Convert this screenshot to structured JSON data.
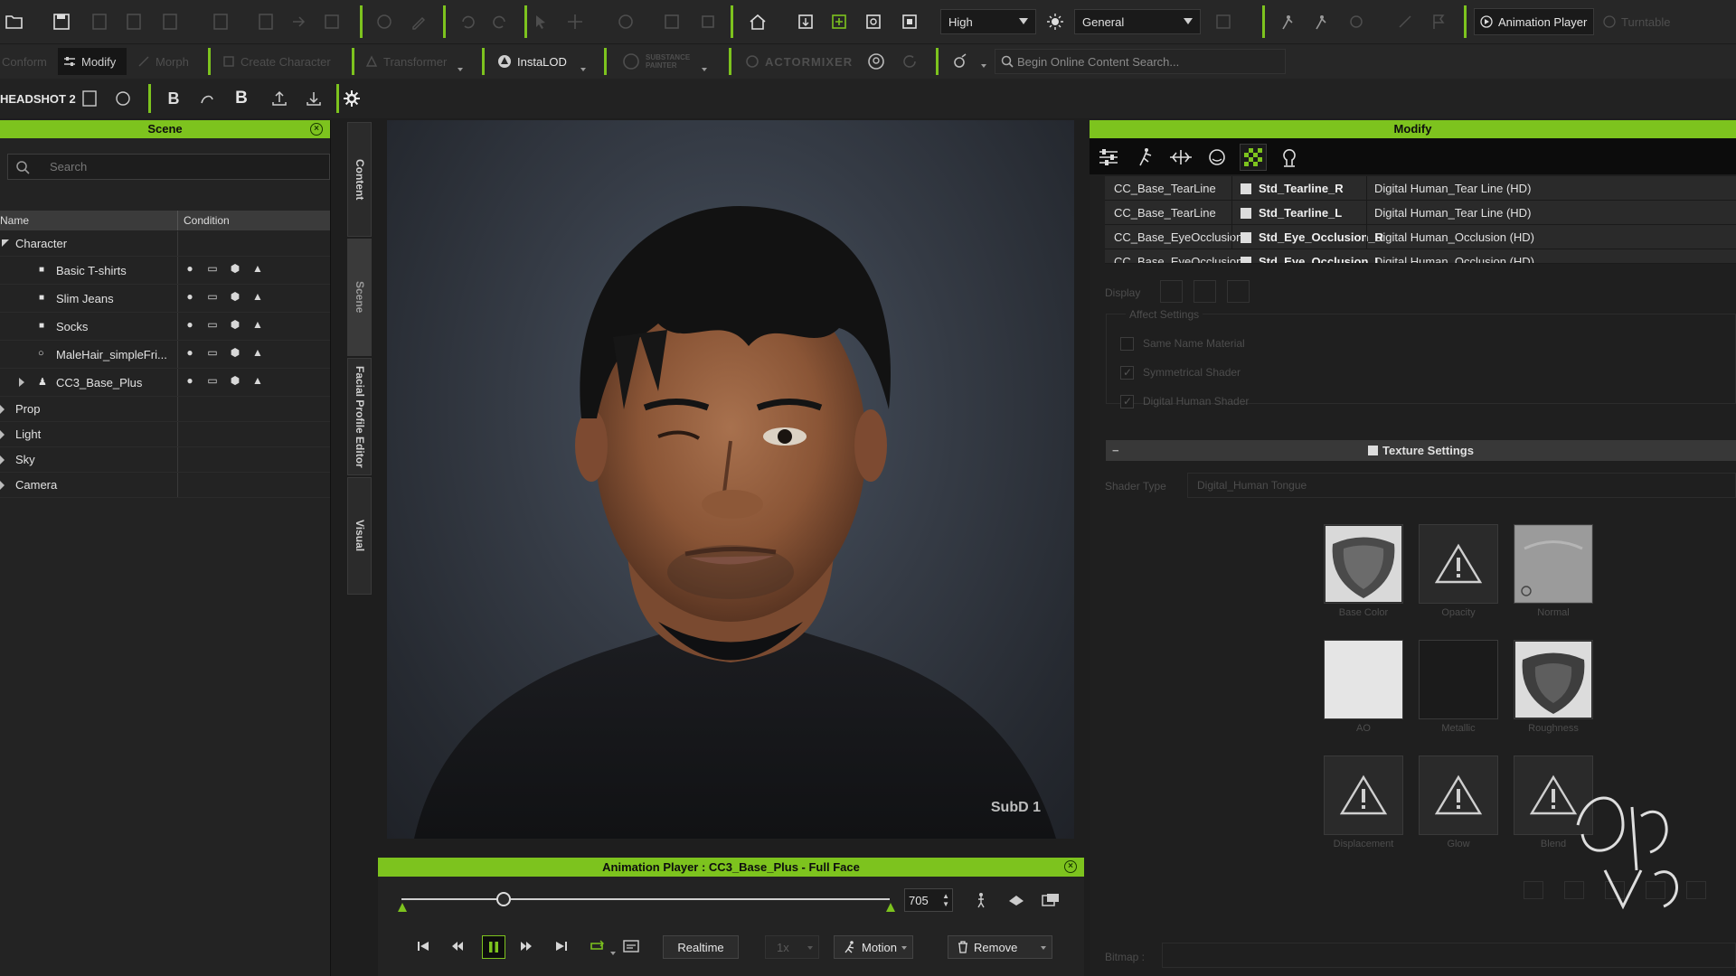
{
  "toolbar": {
    "quality_select": "High",
    "view_select": "General",
    "animation_player_label": "Animation Player",
    "turntable_label": "Turntable",
    "conform_label": "Conform",
    "modify_label": "Modify",
    "morph_label": "Morph",
    "create_character_label": "Create Character",
    "transformer_label": "Transformer",
    "instalod_label": "InstaLOD",
    "substance_label": "SUBSTANCE PAINTER",
    "actormixer_label": "ACTORMIXER",
    "online_search_placeholder": "Begin Online Content Search...",
    "headshot_label": "HEADSHOT 2"
  },
  "scene": {
    "title": "Scene",
    "search_placeholder": "Search",
    "col_name": "Name",
    "col_condition": "Condition",
    "root_character": "Character",
    "children": [
      "Basic T-shirts",
      "Slim Jeans",
      "Socks",
      "MaleHair_simpleFri...",
      "CC3_Base_Plus"
    ],
    "groups": [
      "Prop",
      "Light",
      "Sky",
      "Camera"
    ]
  },
  "side_tabs": [
    "Content",
    "Scene",
    "Facial Profile Editor",
    "Visual"
  ],
  "viewport": {
    "subd_label": "SubD 1"
  },
  "anim_player": {
    "title": "Animation Player : CC3_Base_Plus - Full Face",
    "frame": "705",
    "playhead_fraction": 0.21,
    "realtime_label": "Realtime",
    "speed_label": "1x",
    "motion_label": "Motion",
    "remove_label": "Remove"
  },
  "modify": {
    "title": "Modify",
    "materials": [
      {
        "object": "CC_Base_TearLine",
        "material": "Std_Tearline_R",
        "shader": "Digital Human_Tear Line (HD)"
      },
      {
        "object": "CC_Base_TearLine",
        "material": "Std_Tearline_L",
        "shader": "Digital Human_Tear Line (HD)"
      },
      {
        "object": "CC_Base_EyeOcclusion",
        "material": "Std_Eye_Occlusion_R",
        "shader": "Digital Human_Occlusion (HD)"
      },
      {
        "object": "CC_Base_EyeOcclusion",
        "material": "Std_Eye_Occlusion_L",
        "shader": "Digital Human_Occlusion (HD)"
      }
    ],
    "display_label": "Display",
    "affect_settings_label": "Affect Settings",
    "affect_options": [
      "Same Name Material",
      "Symmetrical Shader",
      "Digital Human Shader"
    ],
    "affect_checked": [
      false,
      true,
      true
    ],
    "texture_settings_label": "Texture Settings",
    "shader_type_label": "Shader Type",
    "shader_type_value": "Digital_Human Tongue",
    "textures": [
      "Base Color",
      "Opacity",
      "Normal",
      "AO",
      "Metallic",
      "Roughness",
      "Displacement",
      "Glow",
      "Blend"
    ],
    "bitmap_label": "Bitmap :"
  }
}
